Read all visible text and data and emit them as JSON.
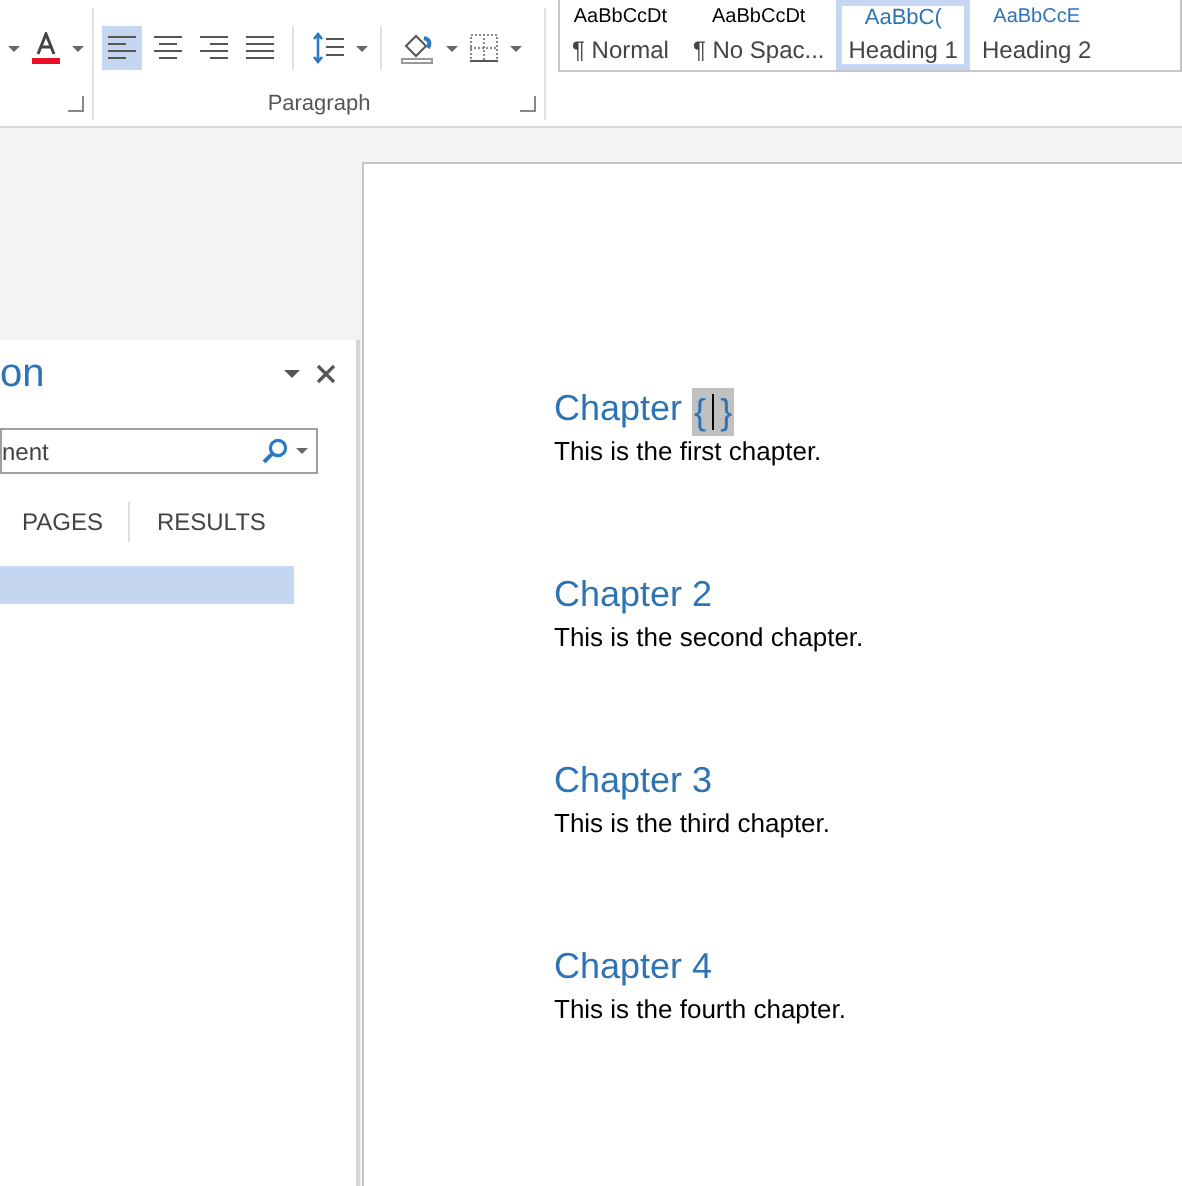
{
  "ribbon": {
    "font_tools": [
      {
        "kind": "font-color"
      }
    ],
    "paragraph_tools": [
      {
        "kind": "align-left",
        "selected": true
      },
      {
        "kind": "align-center",
        "selected": false
      },
      {
        "kind": "align-right",
        "selected": false
      },
      {
        "kind": "justify",
        "selected": false
      },
      {
        "kind": "line-spacing"
      },
      {
        "kind": "shading"
      },
      {
        "kind": "borders"
      }
    ],
    "group_label": "Paragraph",
    "styles": [
      {
        "preview": "AaBbCcDt",
        "name": "¶ Normal",
        "kind": "normal",
        "selected": false
      },
      {
        "preview": "AaBbCcDt",
        "name": "¶ No Spac...",
        "kind": "normal",
        "selected": false
      },
      {
        "preview": "AaBbC(",
        "name": "Heading 1",
        "kind": "heading1",
        "selected": true
      },
      {
        "preview": "AaBbCcE",
        "name": "Heading 2",
        "kind": "heading2",
        "selected": false
      }
    ]
  },
  "nav_pane": {
    "title": "on",
    "search": {
      "value": "nent"
    },
    "tabs": [
      {
        "label": "PAGES",
        "selected": false
      },
      {
        "label": "RESULTS",
        "selected": false
      }
    ],
    "items": [
      {
        "selected": true
      }
    ]
  },
  "document": {
    "sections": [
      {
        "heading": "Chapter",
        "field": {
          "open": "{",
          "close": "}"
        },
        "body": "This is the first chapter."
      },
      {
        "heading": "Chapter 2",
        "body": "This is the second chapter."
      },
      {
        "heading": "Chapter 3",
        "body": "This is the third chapter."
      },
      {
        "heading": "Chapter 4",
        "body": "This is the fourth chapter."
      }
    ]
  }
}
